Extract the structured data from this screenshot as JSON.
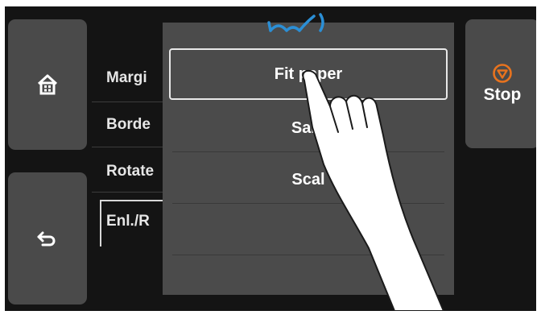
{
  "nav": {
    "home_icon": "home-icon",
    "back_icon": "back-icon"
  },
  "menu": {
    "items": [
      {
        "label": "Margi"
      },
      {
        "label": "Borde"
      },
      {
        "label": "Rotate"
      },
      {
        "label": "Enl./R"
      }
    ]
  },
  "popup": {
    "options": [
      {
        "label": "Fit paper"
      },
      {
        "label": "Sam"
      },
      {
        "label": "Scal"
      },
      {
        "label": ""
      }
    ]
  },
  "stop": {
    "label": "Stop",
    "icon": "stop-icon",
    "color": "#e8731e"
  },
  "hand_icon": "tap-gesture-hand-icon"
}
